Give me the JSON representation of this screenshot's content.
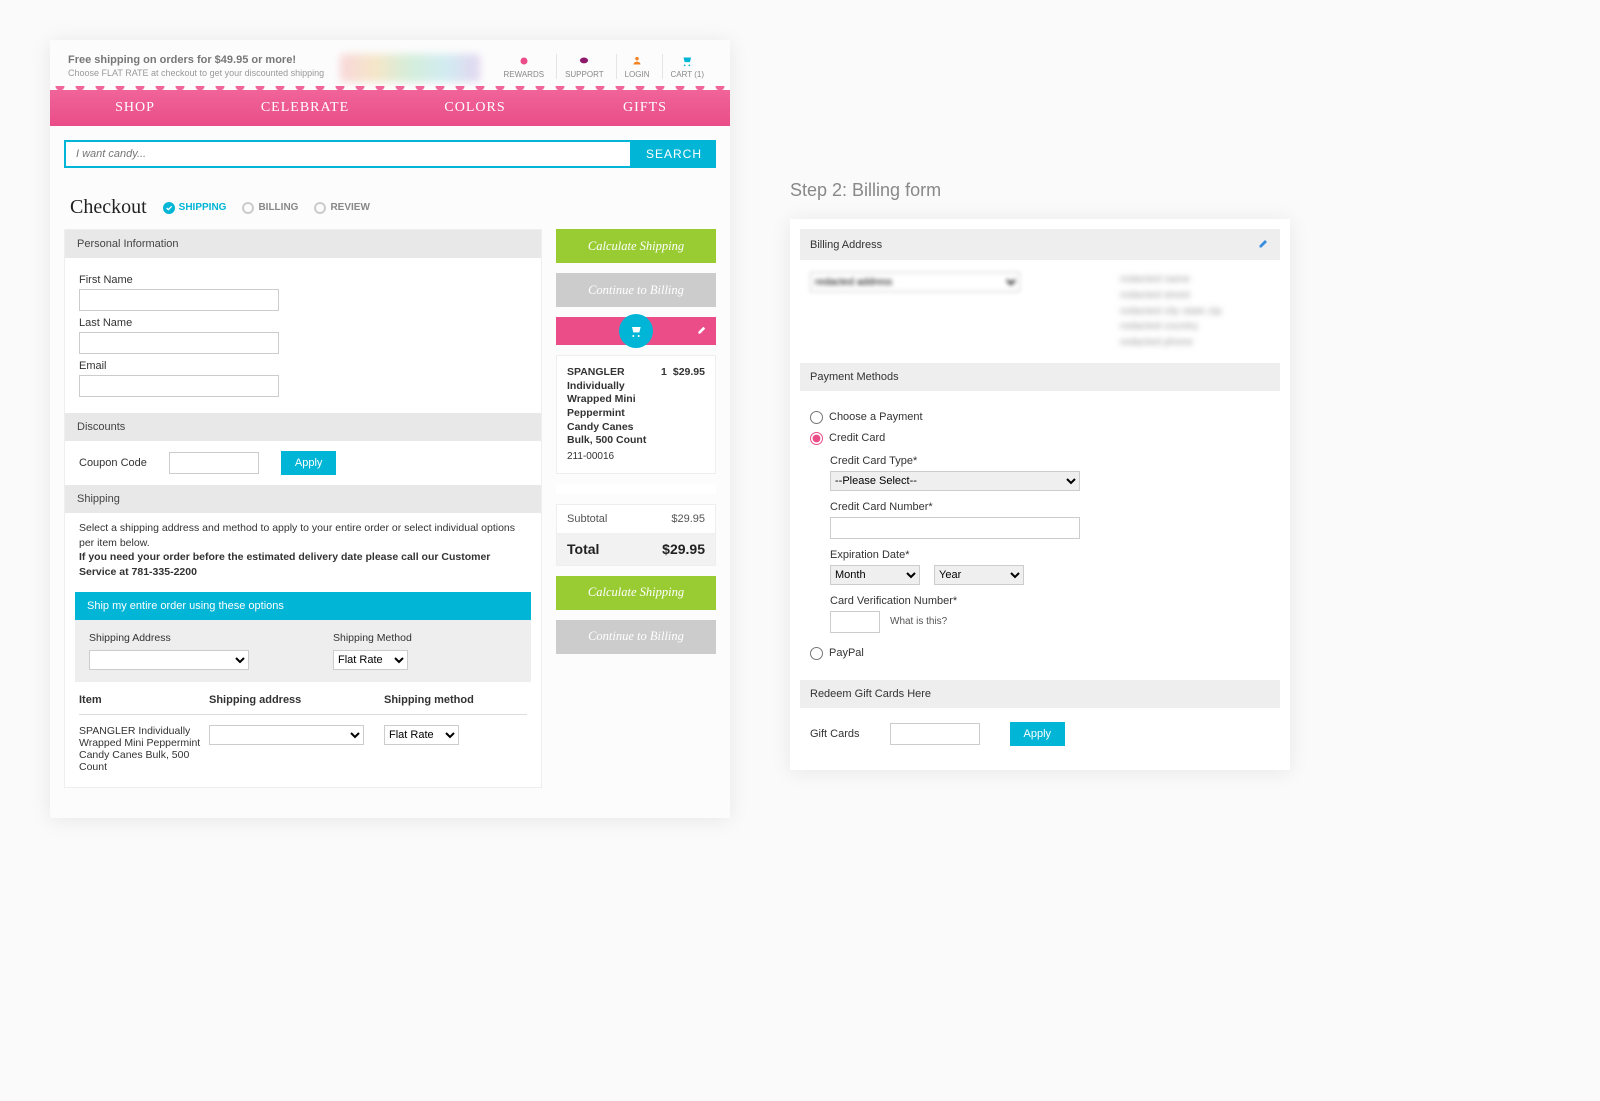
{
  "header": {
    "promo_bold": "Free shipping on orders for $49.95 or more!",
    "promo_sub": "Choose FLAT RATE at checkout to get your discounted shipping",
    "icons": [
      {
        "label": "REWARDS",
        "name": "rewards-icon",
        "color": "#ea4d88"
      },
      {
        "label": "SUPPORT",
        "name": "support-icon",
        "color": "#8e1a6b"
      },
      {
        "label": "LOGIN",
        "name": "login-icon",
        "color": "#f58220"
      },
      {
        "label": "CART (1)",
        "name": "cart-icon",
        "color": "#00b5d6"
      }
    ]
  },
  "nav": [
    "SHOP",
    "CELEBRATE",
    "COLORS",
    "GIFTS"
  ],
  "search": {
    "placeholder": "I want candy...",
    "button": "SEARCH"
  },
  "checkout": {
    "title": "Checkout",
    "steps": [
      {
        "label": "SHIPPING",
        "active": true
      },
      {
        "label": "BILLING",
        "active": false
      },
      {
        "label": "REVIEW",
        "active": false
      }
    ]
  },
  "personal": {
    "section": "Personal Information",
    "first_name_label": "First Name",
    "last_name_label": "Last Name",
    "email_label": "Email"
  },
  "discounts": {
    "section": "Discounts",
    "coupon_label": "Coupon Code",
    "apply": "Apply"
  },
  "shipping": {
    "section": "Shipping",
    "instruction1": "Select a shipping address and method to apply to your entire order or select individual options per item below.",
    "instruction2": "If you need your order before the estimated delivery date please call our Customer Service at 781-335-2200",
    "banner": "Ship my entire order using these options",
    "address_label": "Shipping Address",
    "method_label": "Shipping Method",
    "method_value": "Flat Rate"
  },
  "item_table": {
    "hdr_item": "Item",
    "hdr_addr": "Shipping address",
    "hdr_method": "Shipping method",
    "item_name": "SPANGLER Individually Wrapped Mini Peppermint Candy Canes Bulk, 500 Count",
    "item_method": "Flat Rate"
  },
  "summary": {
    "calc_btn": "Calculate Shipping",
    "continue_btn": "Continue to Billing",
    "line_item": {
      "name": "SPANGLER Individually Wrapped Mini Peppermint Candy Canes Bulk, 500 Count",
      "sku": "211-00016",
      "qty": "1",
      "price": "$29.95"
    },
    "subtotal_label": "Subtotal",
    "subtotal_value": "$29.95",
    "total_label": "Total",
    "total_value": "$29.95"
  },
  "step2": {
    "heading": "Step 2: Billing form",
    "billing_section": "Billing Address",
    "payment_section": "Payment Methods",
    "choose_payment": "Choose a Payment",
    "credit_card": "Credit Card",
    "cc_type_label": "Credit Card Type*",
    "cc_type_placeholder": "--Please Select--",
    "cc_number_label": "Credit Card Number*",
    "exp_label": "Expiration Date*",
    "month": "Month",
    "year": "Year",
    "cvv_label": "Card Verification Number*",
    "what_is_this": "What is this?",
    "paypal": "PayPal",
    "gift_section": "Redeem Gift Cards Here",
    "gift_label": "Gift Cards",
    "apply": "Apply"
  }
}
